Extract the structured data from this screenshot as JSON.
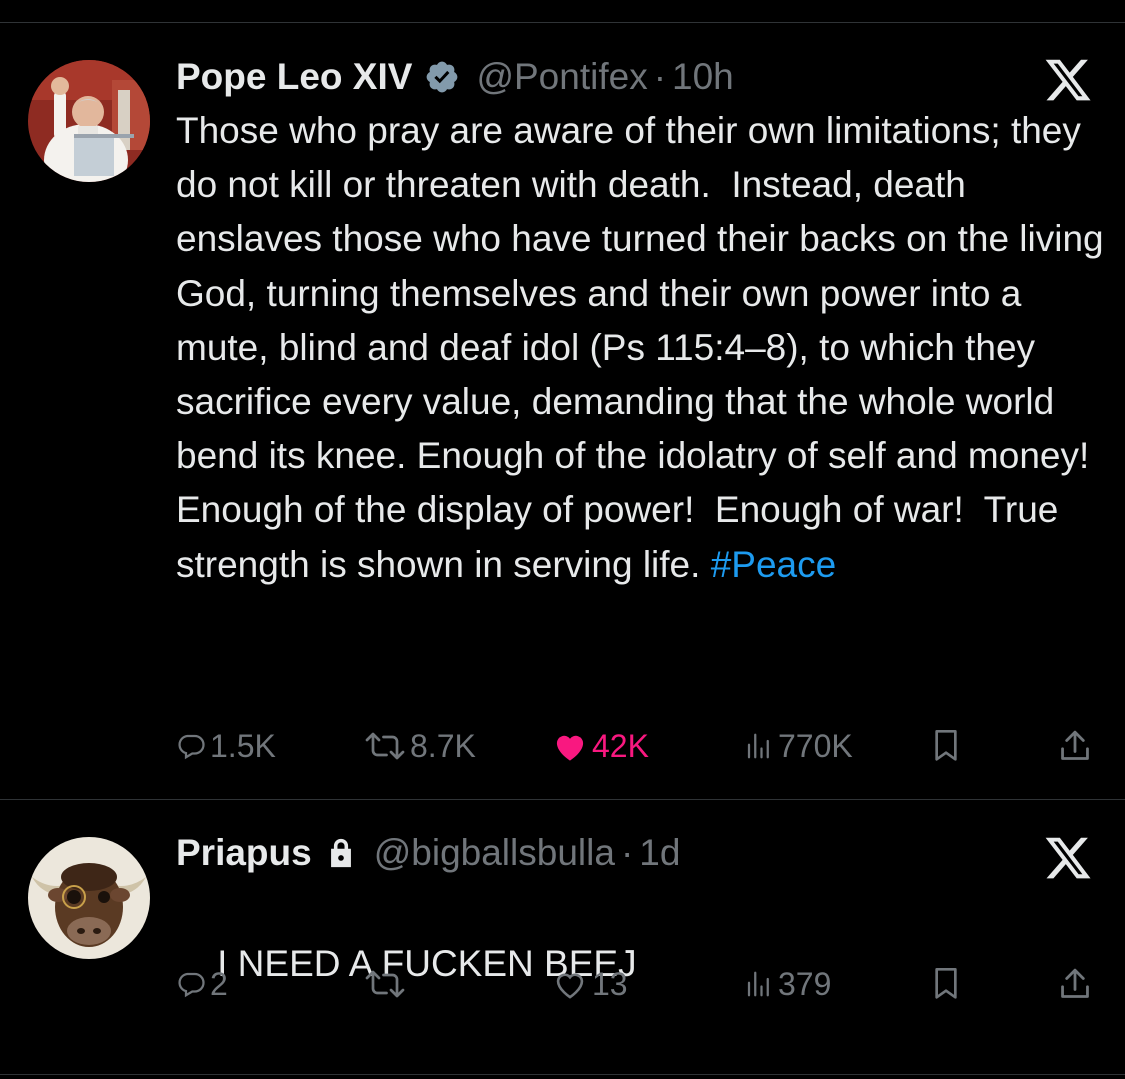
{
  "colors": {
    "background": "#000000",
    "text": "#e7e9ea",
    "muted": "#71767b",
    "hashtag": "#1d9bf0",
    "like_active": "#f91880",
    "verified": "#829aab",
    "divider": "#2f3336"
  },
  "tweets": [
    {
      "name": "Pope Leo XIV",
      "badge_icon": "verified-badge-icon",
      "handle": "@Pontifex",
      "separator": "·",
      "time": "10h",
      "text": "Those who pray are aware of their own limitations; they do not kill or threaten with death.  Instead, death enslaves those who have turned their backs on the living God, turning themselves and their own power into a mute, blind and deaf idol (Ps 115:4–8), to which they sacrifice every value, demanding that the whole world bend its knee. Enough of the idolatry of self and money!  Enough of the display of power!  Enough of war!  True strength is shown in serving life. ",
      "hashtag": "#Peace",
      "actions": {
        "replies": "1.5K",
        "reposts": "8.7K",
        "likes": "42K",
        "views": "770K",
        "liked": true
      }
    },
    {
      "name": "Priapus",
      "badge_icon": "lock-icon",
      "handle": "@bigballsbulla",
      "separator": "·",
      "time": "1d",
      "text": "I NEED A FUCKEN BEEJ",
      "actions": {
        "replies": "2",
        "reposts": "",
        "likes": "13",
        "views": "379",
        "liked": false
      }
    }
  ]
}
